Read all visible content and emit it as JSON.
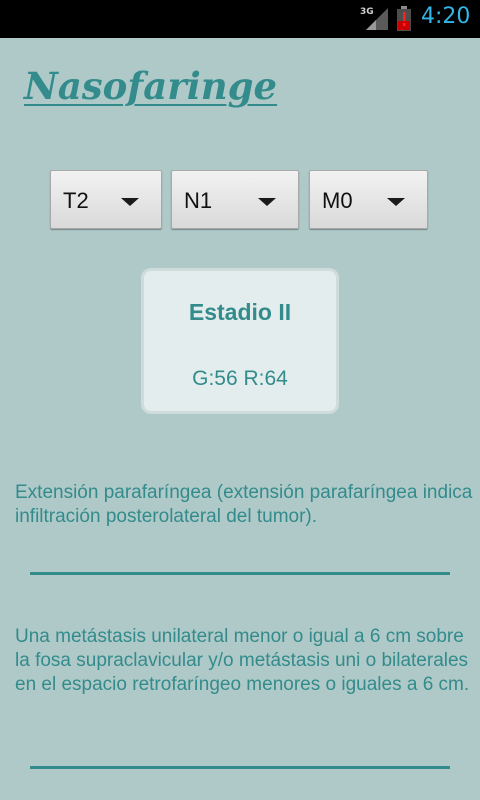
{
  "status_bar": {
    "network_type": "3G",
    "time": "4:20",
    "time_color": "#33b5e5"
  },
  "title": "Nasofaringe",
  "colors": {
    "background": "#afc9c9",
    "accent": "#338b8b",
    "card": "#e3eded"
  },
  "selectors": {
    "t": {
      "value": "T2"
    },
    "n": {
      "value": "N1"
    },
    "m": {
      "value": "M0"
    }
  },
  "stage": {
    "label": "Estadio II",
    "scores": "G:56 R:64"
  },
  "descriptions": {
    "t": "Extensión parafaríngea (extensión parafaríngea indica infiltración posterolateral del tumor).",
    "n": "Una metástasis unilateral menor o igual a 6 cm sobre la fosa supraclavicular y/o metástasis uni o bilaterales en el espacio retrofaríngeo menores o iguales a 6 cm."
  }
}
